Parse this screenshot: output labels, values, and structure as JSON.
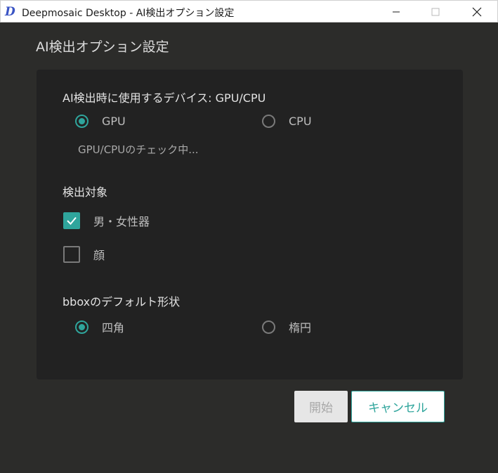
{
  "titlebar": {
    "app_icon_glyph": "D",
    "title": "Deepmosaic Desktop - AI検出オプション設定",
    "controls": [
      "minimize-icon",
      "maximize-icon",
      "close-icon"
    ]
  },
  "dialog": {
    "heading": "AI検出オプション設定"
  },
  "device_section": {
    "title": "AI検出時に使用するデバイス: GPU/CPU",
    "options": [
      {
        "label": "GPU",
        "checked": true
      },
      {
        "label": "CPU",
        "checked": false
      }
    ],
    "status": "GPU/CPUのチェック中..."
  },
  "target_section": {
    "title": "検出対象",
    "options": [
      {
        "label": "男・女性器",
        "checked": true
      },
      {
        "label": "顔",
        "checked": false
      }
    ]
  },
  "bbox_section": {
    "title": "bboxのデフォルト形状",
    "options": [
      {
        "label": "四角",
        "checked": true
      },
      {
        "label": "楕円",
        "checked": false
      }
    ]
  },
  "buttons": {
    "start": "開始",
    "start_enabled": false,
    "cancel": "キャンセル"
  },
  "colors": {
    "accent": "#2fa59c",
    "background": "#2c2c2a",
    "panel": "#222222",
    "titlebar": "#ffffff"
  }
}
